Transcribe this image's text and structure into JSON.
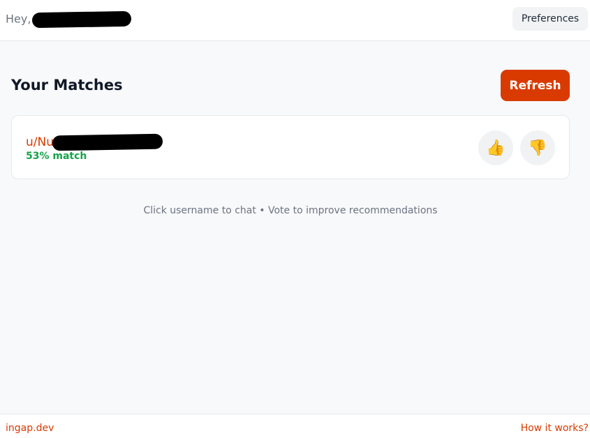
{
  "header": {
    "greeting": "Hey,",
    "preferences_label": "Preferences"
  },
  "main": {
    "title": "Your Matches",
    "refresh_label": "Refresh",
    "matches": [
      {
        "username_visible": "u/Nu",
        "score": "53% match",
        "thumbs_up_icon": "👍",
        "thumbs_down_icon": "👎"
      }
    ],
    "hint": "Click username to chat • Vote to improve recommendations"
  },
  "footer": {
    "brand": "ingap.dev",
    "how_label": "How it works?"
  },
  "colors": {
    "accent": "#d93a00",
    "match_green": "#16a34a",
    "muted_text": "#6b7280"
  }
}
